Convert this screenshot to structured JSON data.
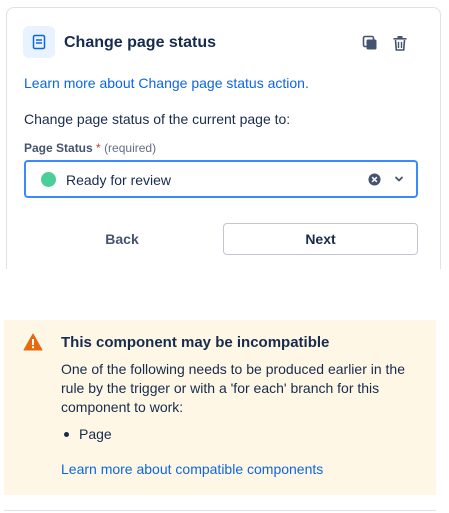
{
  "action": {
    "title": "Change page status",
    "icon": "page-icon",
    "learn_more_link": "Learn more about Change page status action.",
    "description": "Change page status of the current page to:"
  },
  "field": {
    "label": "Page Status",
    "required_mark": "*",
    "required_text": "(required)",
    "selected_value": "Ready for review",
    "status_color": "#4bce97"
  },
  "buttons": {
    "back": "Back",
    "next": "Next"
  },
  "warning": {
    "title": "This component may be incompatible",
    "body": "One of the following needs to be produced earlier in the rule by the trigger or with a 'for each' branch for this component to work:",
    "items": [
      "Page"
    ],
    "link": "Learn more about compatible components"
  },
  "colors": {
    "accent": "#0c66e4",
    "warning_bg": "#fff7e6",
    "warning_icon": "#e56910",
    "focus_border": "#388bff"
  }
}
